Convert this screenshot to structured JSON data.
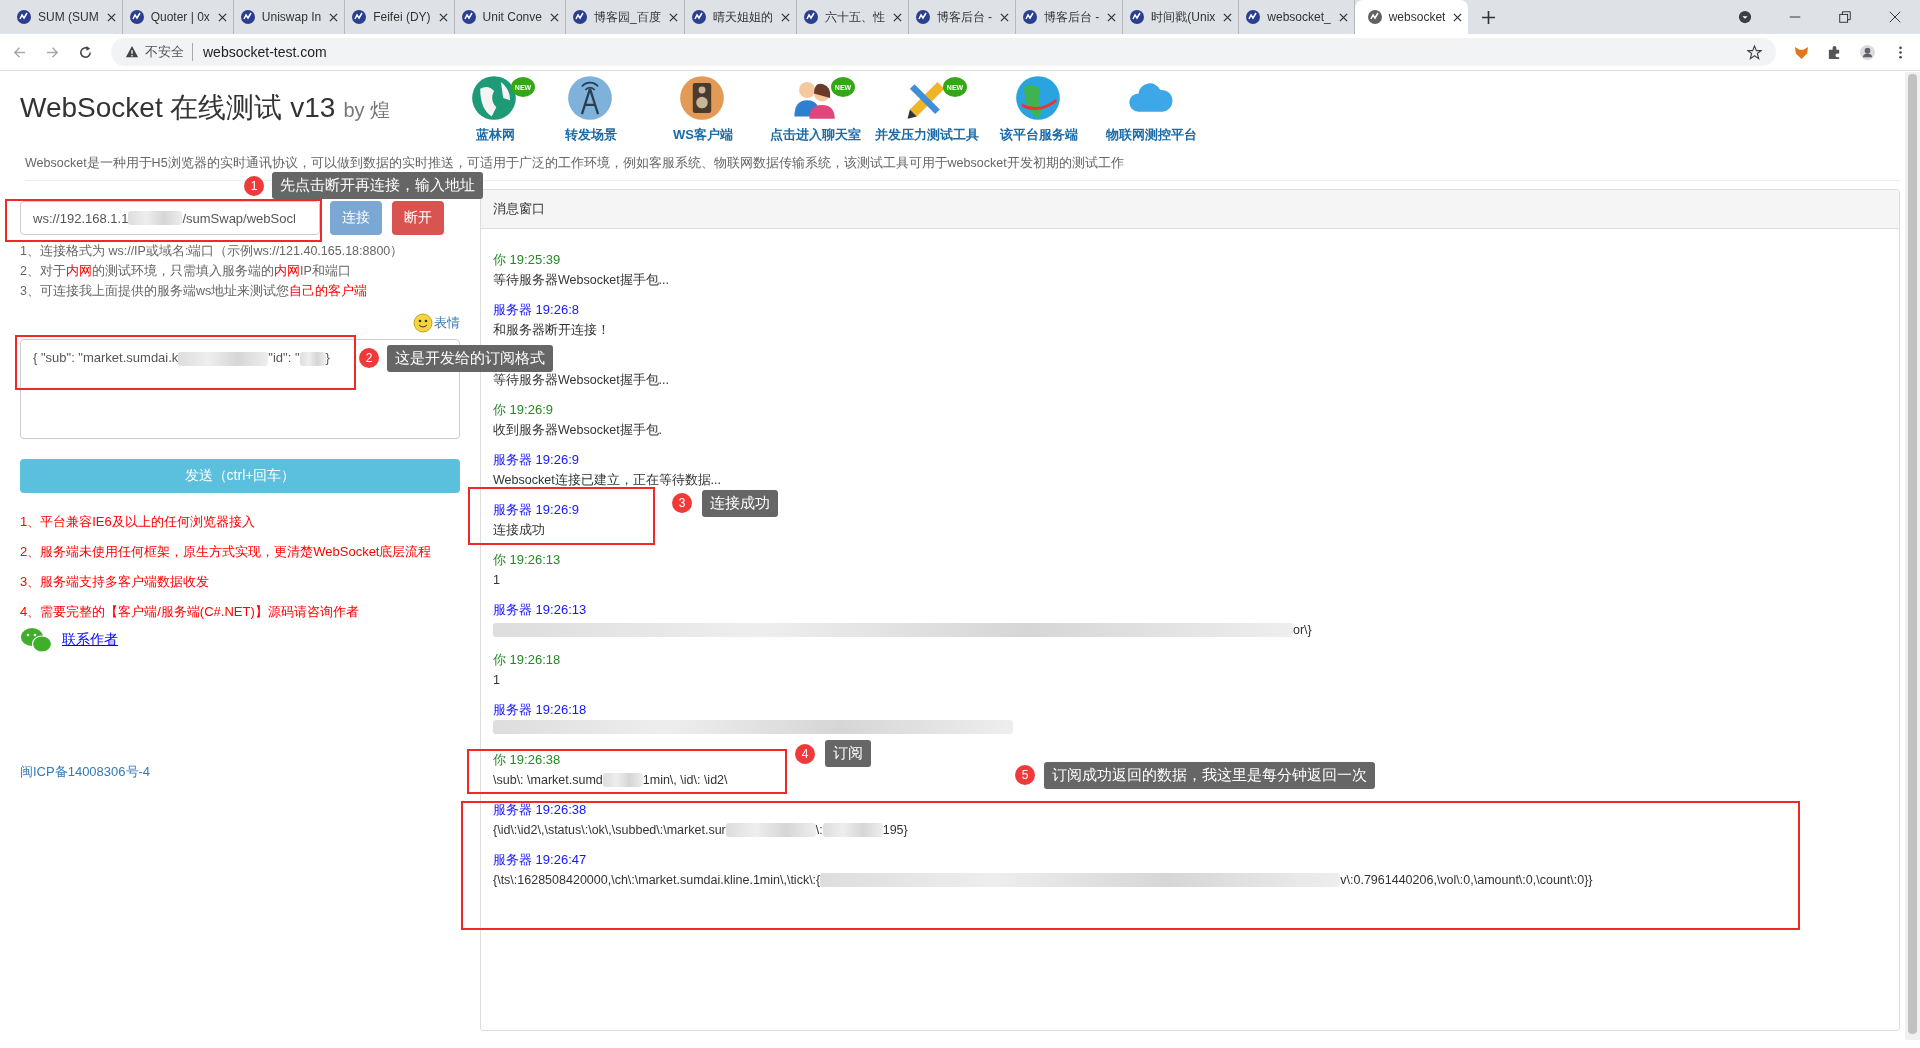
{
  "browser": {
    "tabs": [
      {
        "title": "SUM (SUM",
        "selected": false
      },
      {
        "title": "Quoter | 0x",
        "selected": false
      },
      {
        "title": "Uniswap In",
        "selected": false
      },
      {
        "title": "Feifei (DY)",
        "selected": false
      },
      {
        "title": "Unit Conve",
        "selected": false
      },
      {
        "title": "博客园_百度",
        "selected": false
      },
      {
        "title": "晴天姐姐的",
        "selected": false
      },
      {
        "title": "六十五、性",
        "selected": false
      },
      {
        "title": "博客后台 -",
        "selected": false
      },
      {
        "title": "博客后台 -",
        "selected": false
      },
      {
        "title": "时间戳(Unix",
        "selected": false
      },
      {
        "title": "websocket_",
        "selected": false
      },
      {
        "title": "websocket",
        "selected": true
      }
    ],
    "security_label": "不安全",
    "url": "websocket-test.com"
  },
  "header": {
    "title": "WebSocket 在线测试 v13",
    "byline": "by 煌",
    "nav": [
      {
        "label": "蓝林网",
        "badge": "NEW"
      },
      {
        "label": "转发场景"
      },
      {
        "label": "WS客户端"
      },
      {
        "label": "点击进入聊天室",
        "badge": "NEW"
      },
      {
        "label": "并发压力测试工具",
        "badge": "NEW"
      },
      {
        "label": "该平台服务端"
      },
      {
        "label": "物联网测控平台"
      }
    ],
    "description": "Websocket是一种用于H5浏览器的实时通讯协议，可以做到数据的实时推送，可适用于广泛的工作环境，例如客服系统、物联网数据传输系统，该测试工具可用于websocket开发初期的测试工作"
  },
  "connection": {
    "url_parts": [
      {
        "kind": "text",
        "text": "ws://192.168.1.1"
      },
      {
        "kind": "redacted"
      },
      {
        "kind": "text",
        "text": "/sumSwap/webSocl"
      }
    ],
    "connect_button": "连接",
    "disconnect_button": "断开",
    "tips": [
      [
        {
          "text": "1、连接格式为 ws://IP或域名:端口（示例ws://121.40.165.18:8800）",
          "highlight": false
        }
      ],
      [
        {
          "text": "2、对于",
          "highlight": false
        },
        {
          "text": "内网",
          "highlight": true
        },
        {
          "text": "的测试环境，只需填入服务端的",
          "highlight": false
        },
        {
          "text": "内网",
          "highlight": true
        },
        {
          "text": "IP和端口",
          "highlight": false
        }
      ],
      [
        {
          "text": "3、可连接我上面提供的服务端ws地址来测试您",
          "highlight": false
        },
        {
          "text": "自己的客户端",
          "highlight": true
        }
      ]
    ]
  },
  "composer": {
    "emoji_label": "表情",
    "input_parts": [
      {
        "kind": "text",
        "text": "{ \"sub\": \"market.sumdai.k"
      },
      {
        "kind": "redacted"
      },
      {
        "kind": "text",
        "text": "\"id\": \""
      },
      {
        "kind": "redacted"
      },
      {
        "kind": "text",
        "text": "}"
      }
    ],
    "send_button": "发送（ctrl+回车）"
  },
  "notices": [
    "1、平台兼容IE6及以上的任何浏览器接入",
    "2、服务端未使用任何框架，原生方式实现，更清楚WebSocket底层流程",
    "3、服务端支持多客户端数据收发",
    "4、需要完整的【客户端/服务端(C#.NET)】源码请咨询作者"
  ],
  "contact_link": "联系作者",
  "icp": "闽ICP备14008306号-4",
  "messages_panel": {
    "title": "消息窗口",
    "messages": [
      {
        "kind": "you",
        "header": "你 19:25:39",
        "body": [
          {
            "kind": "text",
            "text": "等待服务器Websocket握手包..."
          }
        ]
      },
      {
        "kind": "server",
        "header": "服务器 19:26:8",
        "body": [
          {
            "kind": "text",
            "text": "和服务器断开连接！"
          }
        ]
      },
      {
        "body": [
          {
            "kind": "text",
            "text": "等待服务器Websocket握手包..."
          }
        ]
      },
      {
        "kind": "you",
        "header": "你 19:26:9",
        "body": [
          {
            "kind": "text",
            "text": "收到服务器Websocket握手包."
          }
        ]
      },
      {
        "kind": "server",
        "header": "服务器 19:26:9",
        "body": [
          {
            "kind": "text",
            "text": "Websocket连接已建立，正在等待数据..."
          }
        ]
      },
      {
        "kind": "server",
        "header": "服务器 19:26:9",
        "body": [
          {
            "kind": "text",
            "text": "连接成功"
          }
        ]
      },
      {
        "kind": "you",
        "header": "你 19:26:13",
        "body": [
          {
            "kind": "text",
            "text": "1"
          }
        ]
      },
      {
        "kind": "server",
        "header": "服务器 19:26:13",
        "body": [
          {
            "kind": "redacted"
          },
          {
            "kind": "text",
            "text": "or\\}"
          }
        ]
      },
      {
        "kind": "you",
        "header": "你 19:26:18",
        "body": [
          {
            "kind": "text",
            "text": "1"
          }
        ]
      },
      {
        "kind": "server",
        "header": "服务器 19:26:18",
        "body": [
          {
            "kind": "redacted"
          }
        ]
      },
      {
        "kind": "you",
        "header": "你 19:26:38",
        "body": [
          {
            "kind": "text",
            "text": "\\sub\\: \\market.sumd"
          },
          {
            "kind": "redacted"
          },
          {
            "kind": "text",
            "text": "1min\\, \\id\\: \\id2\\"
          }
        ]
      },
      {
        "kind": "server",
        "header": "服务器 19:26:38",
        "body": [
          {
            "kind": "text",
            "text": "{\\id\\:\\id2\\,\\status\\:\\ok\\,\\subbed\\:\\market.sur"
          },
          {
            "kind": "redacted"
          },
          {
            "kind": "text",
            "text": "\\:"
          },
          {
            "kind": "redacted"
          },
          {
            "kind": "text",
            "text": "195}"
          }
        ]
      },
      {
        "kind": "server",
        "header": "服务器 19:26:47",
        "body": [
          {
            "kind": "text",
            "text": "{\\ts\\:1628508420000,\\ch\\:\\market.sumdai.kline.1min\\,\\tick\\:{"
          },
          {
            "kind": "redacted"
          },
          {
            "kind": "text",
            "text": "v\\:0.7961440206,\\vol\\:0,\\amount\\:0,\\count\\:0}}"
          }
        ]
      }
    ]
  },
  "annotations": [
    {
      "number": "1",
      "text": "先点击断开再连接，输入地址"
    },
    {
      "number": "2",
      "text": "这是开发给的订阅格式"
    },
    {
      "number": "3",
      "text": "连接成功"
    },
    {
      "number": "4",
      "text": "订阅"
    },
    {
      "number": "5",
      "text": "订阅成功返回的数据，我这里是每分钟返回一次"
    }
  ]
}
